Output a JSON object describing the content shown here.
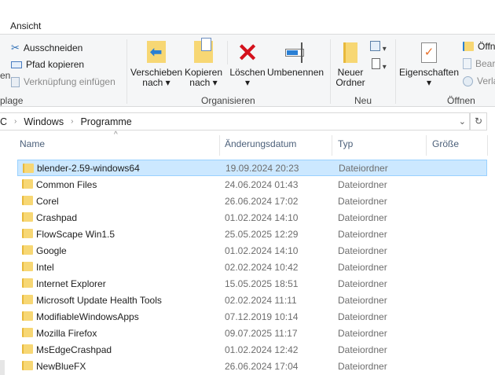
{
  "ribbon_tabs": {
    "view": "Ansicht"
  },
  "clipboard": {
    "partial_left": "en",
    "cut": "Ausschneiden",
    "copy_path": "Pfad kopieren",
    "paste_shortcut": "Verknüpfung einfügen",
    "group_label": "plage"
  },
  "organize": {
    "move_to": [
      "Verschieben",
      "nach"
    ],
    "copy_to": [
      "Kopieren",
      "nach"
    ],
    "delete": "Löschen",
    "rename": "Umbenennen",
    "group_label": "Organisieren"
  },
  "new": {
    "new_folder": [
      "Neuer",
      "Ordner"
    ],
    "group_label": "Neu"
  },
  "open": {
    "properties": "Eigenschaften",
    "open": "Öffn",
    "edit": "Bear",
    "history": "Verla",
    "group_label": "Öffnen"
  },
  "breadcrumb": [
    "C",
    "Windows",
    "Programme"
  ],
  "columns": {
    "name": "Name",
    "date": "Änderungsdatum",
    "type": "Typ",
    "size": "Größe"
  },
  "files": [
    {
      "name": "blender-2.59-windows64",
      "date": "19.09.2024 20:23",
      "type": "Dateiordner",
      "selected": true
    },
    {
      "name": "Common Files",
      "date": "24.06.2024 01:43",
      "type": "Dateiordner"
    },
    {
      "name": "Corel",
      "date": "26.06.2024 17:02",
      "type": "Dateiordner"
    },
    {
      "name": "Crashpad",
      "date": "01.02.2024 14:10",
      "type": "Dateiordner"
    },
    {
      "name": "FlowScape Win1.5",
      "date": "25.05.2025 12:29",
      "type": "Dateiordner"
    },
    {
      "name": "Google",
      "date": "01.02.2024 14:10",
      "type": "Dateiordner"
    },
    {
      "name": "Intel",
      "date": "02.02.2024 10:42",
      "type": "Dateiordner"
    },
    {
      "name": "Internet Explorer",
      "date": "15.05.2025 18:51",
      "type": "Dateiordner"
    },
    {
      "name": "Microsoft Update Health Tools",
      "date": "02.02.2024 11:11",
      "type": "Dateiordner"
    },
    {
      "name": "ModifiableWindowsApps",
      "date": "07.12.2019 10:14",
      "type": "Dateiordner"
    },
    {
      "name": "Mozilla Firefox",
      "date": "09.07.2025 11:17",
      "type": "Dateiordner"
    },
    {
      "name": "MsEdgeCrashpad",
      "date": "01.02.2024 12:42",
      "type": "Dateiordner"
    },
    {
      "name": "NewBlueFX",
      "date": "26.06.2024 17:04",
      "type": "Dateiordner"
    }
  ]
}
